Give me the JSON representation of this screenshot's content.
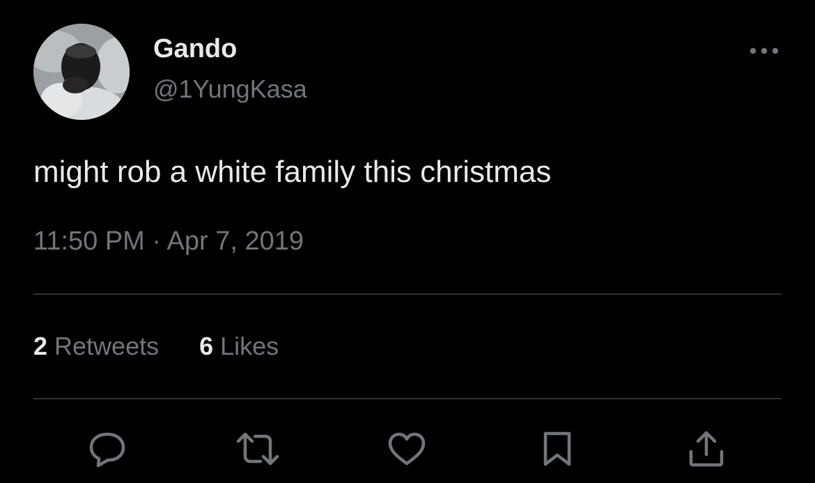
{
  "author": {
    "display_name": "Gando",
    "handle": "@1YungKasa"
  },
  "tweet": {
    "text": "might rob a white family this christmas",
    "timestamp": "11:50 PM · Apr 7, 2019"
  },
  "stats": {
    "retweets_count": "2",
    "retweets_label": "Retweets",
    "likes_count": "6",
    "likes_label": "Likes"
  },
  "icons": {
    "more": "more-horizontal-icon",
    "reply": "reply-icon",
    "retweet": "retweet-icon",
    "like": "heart-icon",
    "bookmark": "bookmark-icon",
    "share": "share-icon"
  },
  "colors": {
    "background": "#000000",
    "primary_text": "#e7e9ea",
    "secondary_text": "#71767b",
    "divider": "#2f3336"
  }
}
